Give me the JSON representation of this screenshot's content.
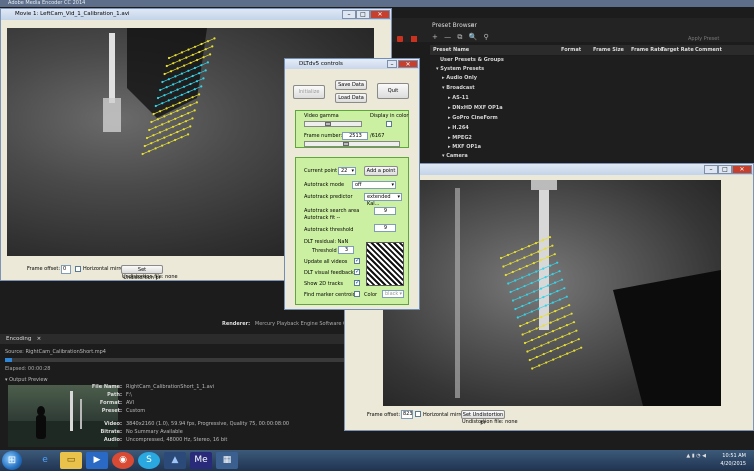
{
  "ame": {
    "window_title": "Adobe Media Encoder CC 2014",
    "preset_browser_title": "Preset Browser",
    "preset_close": "×",
    "preset_tools": "+ — ⧉ 🔍 ⚲",
    "apply_preset": "Apply Preset",
    "preset_columns": [
      "Preset Name",
      "Format",
      "Frame Size",
      "Frame Rate",
      "Target Rate",
      "Comment"
    ],
    "user_presets": "User Presets & Groups",
    "system_presets": "System Presets",
    "presets": [
      {
        "label": "Audio Only",
        "indent": 1,
        "arrow": "▸"
      },
      {
        "label": "Broadcast",
        "indent": 1,
        "arrow": "▾"
      },
      {
        "label": "AS-11",
        "indent": 2,
        "arrow": "▸"
      },
      {
        "label": "DNxHD MXF OP1a",
        "indent": 2,
        "arrow": "▸"
      },
      {
        "label": "GoPro CineForm",
        "indent": 2,
        "arrow": "▸"
      },
      {
        "label": "H.264",
        "indent": 2,
        "arrow": "▸"
      },
      {
        "label": "MPEG2",
        "indent": 2,
        "arrow": "▸"
      },
      {
        "label": "MXF OP1a",
        "indent": 2,
        "arrow": "▸"
      },
      {
        "label": "Camera",
        "indent": 1,
        "arrow": "▾"
      }
    ],
    "renderer_label": "Renderer:",
    "renderer_value": "Mercury Playback Engine Software Only",
    "encoding_tab": "Encoding",
    "encoding_close": "×",
    "source": "Source: RightCam_CalibrationShort.mp4",
    "elapsed": "Elapsed: 00:00:28",
    "output_preview": "Output Preview",
    "meta": [
      {
        "k": "File Name:",
        "v": "RightCam_CalibrationShort_1_1.avi"
      },
      {
        "k": "Path:",
        "v": "F:\\"
      },
      {
        "k": "Format:",
        "v": "AVI"
      },
      {
        "k": "Preset:",
        "v": "Custom"
      },
      {
        "k": "Video:",
        "v": "3840x2160 (1.0), 59.94 fps, Progressive, Quality 75, 00:00:08:00"
      },
      {
        "k": "Bitrate:",
        "v": "No Summary Available"
      },
      {
        "k": "Audio:",
        "v": "Uncompressed, 48000 Hz, Stereo, 16 bit"
      }
    ],
    "progress": 0.02
  },
  "movie1": {
    "title": "Movie 1: LeftCam_Vid_1_Calibration_1.avi",
    "frame_offset_label": "Frame offset:",
    "frame_offset_value": "0",
    "horizontal_mirror": "Horizontal mirror",
    "set_undistortion": "Set Undistortion pr",
    "undistortion_file": "Undistortion file: none"
  },
  "movie2": {
    "frame_offset_label": "Frame offset:",
    "frame_offset_value": "823",
    "horizontal_mirror": "Horizontal mirror",
    "set_undistortion": "Set Undistortion pr",
    "undistortion_file": "Undistortion file: none"
  },
  "dlt": {
    "title": "DLTdv5 controls",
    "initialize": "Initialize",
    "save_data": "Save Data",
    "load_data": "Load Data",
    "quit": "Quit",
    "video_gamma": "Video gamma",
    "display_in_color": "Display in color",
    "frame_number_label": "Frame number:",
    "frame_number_value": "2513",
    "frame_total": "/6167",
    "current_point_label": "Current point",
    "current_point_value": "22",
    "add_point": "Add a point",
    "autotrack_mode_label": "Autotrack mode",
    "autotrack_mode_value": "off",
    "autotrack_predictor_label": "Autotrack predictor",
    "autotrack_predictor_value": "extended Kal...",
    "search_area_label": "Autotrack search area",
    "search_area_value": "9",
    "autotrack_fit_label": "Autotrack fit --",
    "threshold_label": "Autotrack threshold",
    "threshold_value": "9",
    "dlt_residual": "DLT residual: NaN",
    "threshold2_label": "Threshold",
    "threshold2_value": "3",
    "update_all_videos": "Update all videos",
    "dlt_visual_feedback": "DLT visual feedback",
    "show_2d_tracks": "Show 2D tracks",
    "find_marker_centroid": "Find marker centroid",
    "color_label": "Color",
    "color_value": "black"
  },
  "taskbar": {
    "start_glyph": "⊞",
    "time": "10:51 AM",
    "date": "4/20/2015"
  }
}
